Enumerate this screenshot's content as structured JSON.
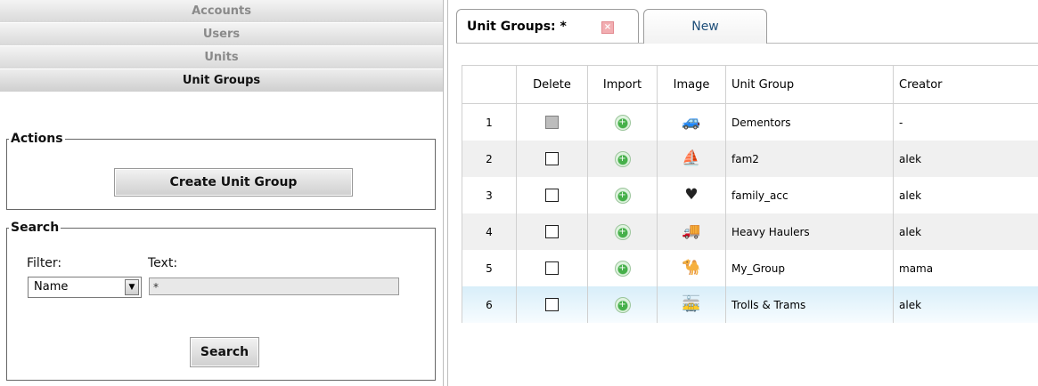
{
  "nav": {
    "items": [
      {
        "label": "Accounts",
        "active": false
      },
      {
        "label": "Users",
        "active": false
      },
      {
        "label": "Units",
        "active": false
      },
      {
        "label": "Unit Groups",
        "active": true
      }
    ]
  },
  "actions": {
    "legend": "Actions",
    "create_label": "Create Unit Group"
  },
  "search": {
    "legend": "Search",
    "filter_label": "Filter:",
    "text_label": "Text:",
    "filter_value": "Name",
    "text_value": "*",
    "button_label": "Search"
  },
  "tabs": [
    {
      "label": "Unit Groups: *",
      "active": true
    },
    {
      "label": "New",
      "active": false
    }
  ],
  "table": {
    "headers": [
      "",
      "Delete",
      "Import",
      "Image",
      "Unit Group",
      "Creator"
    ],
    "rows": [
      {
        "num": "1",
        "delete_enabled": false,
        "image": "car-icon",
        "group": "Dementors",
        "creator": "-"
      },
      {
        "num": "2",
        "delete_enabled": true,
        "image": "sailboat-icon",
        "group": "fam2",
        "creator": "alek"
      },
      {
        "num": "3",
        "delete_enabled": true,
        "image": "heart-icon",
        "group": "family_acc",
        "creator": "alek"
      },
      {
        "num": "4",
        "delete_enabled": true,
        "image": "truck-icon",
        "group": "Heavy Haulers",
        "creator": "alek"
      },
      {
        "num": "5",
        "delete_enabled": true,
        "image": "camel-icon",
        "group": "My_Group",
        "creator": "mama"
      },
      {
        "num": "6",
        "delete_enabled": true,
        "image": "tram-icon",
        "group": "Trolls & Trams",
        "creator": "alek"
      }
    ],
    "selected_row": "6"
  },
  "colors": {
    "selected_row": "#d8eef9",
    "tab_close": "#f2aeb2",
    "new_tab_text": "#1f4f7a"
  }
}
